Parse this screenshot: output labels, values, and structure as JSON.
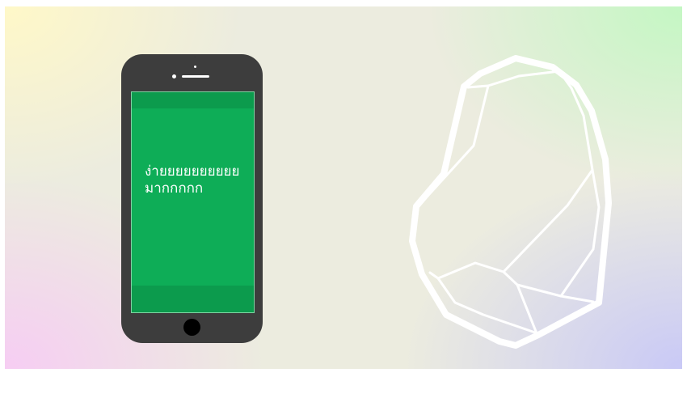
{
  "phone": {
    "screen_text_line1": "ง่ายยยยยยยยยย",
    "screen_text_line2": "มากกกกก",
    "screen_color": "#0ead57",
    "body_color": "#3d3d3d"
  },
  "gem": {
    "icon": "gemstone-outline-icon",
    "stroke_color": "#ffffff"
  }
}
